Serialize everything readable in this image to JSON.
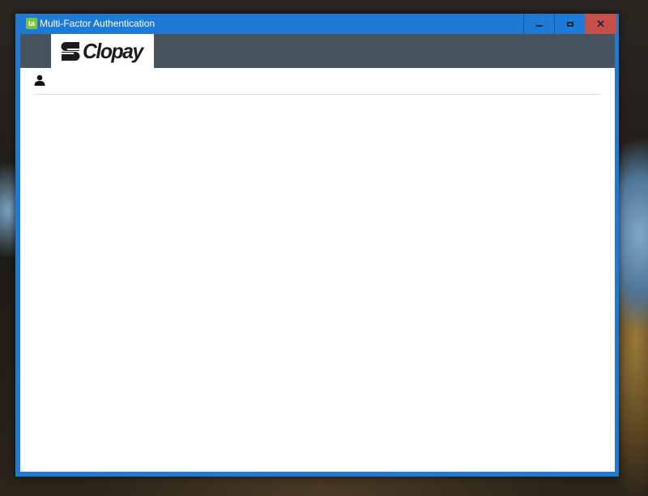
{
  "window": {
    "title": "Multi-Factor Authentication",
    "app_icon": "app-logo-icon",
    "app_icon_glyph": "ta",
    "controls": {
      "minimize": "minimize-icon",
      "maximize": "maximize-icon",
      "close": "close-icon",
      "close_glyph": "✕"
    },
    "colors": {
      "titlebar": "#1f7ad6",
      "close_button": "#c74f4a",
      "brand_bar": "#47535d"
    }
  },
  "brand": {
    "logo_text": "Clopay",
    "logo_icon": "clopay-logo-icon"
  },
  "user": {
    "icon": "user-icon"
  }
}
